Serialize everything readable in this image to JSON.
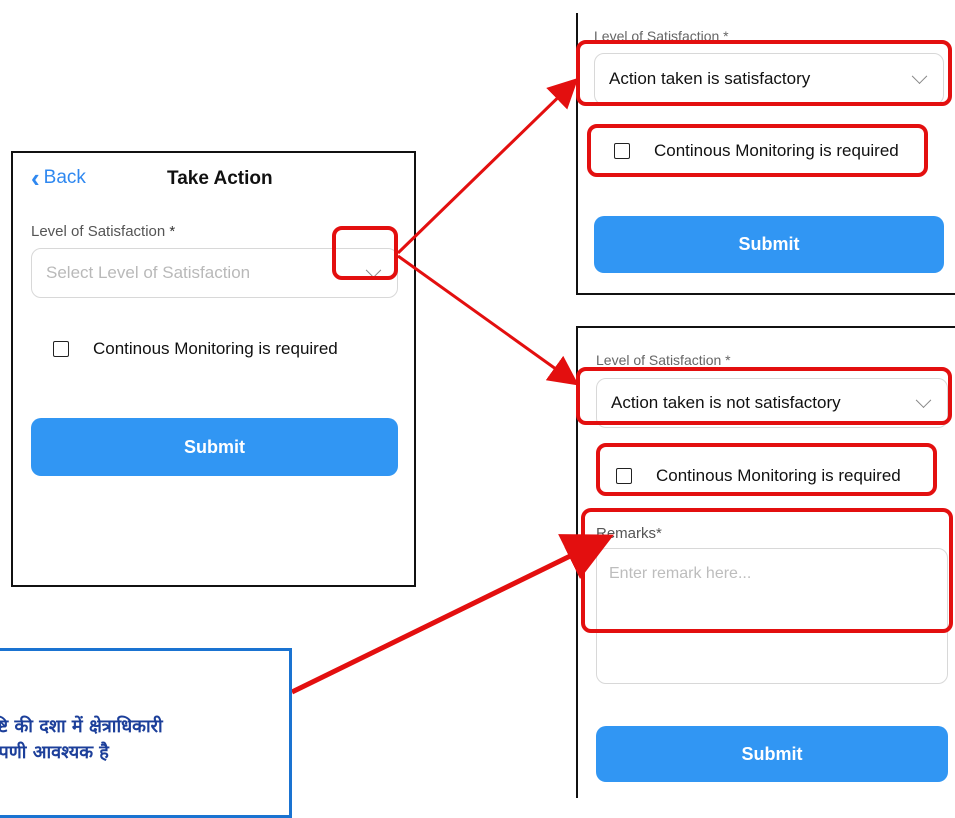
{
  "main_screen": {
    "back_label": "Back",
    "title": "Take Action",
    "satisfaction_label": "Level of Satisfaction",
    "required_mark": "*",
    "select_placeholder": "Select Level of Satisfaction",
    "checkbox_label": "Continous Monitoring is required",
    "submit_label": "Submit"
  },
  "satisfactory_screen": {
    "satisfaction_label": "Level of Satisfaction *",
    "selected_value": "Action taken is satisfactory",
    "checkbox_label": "Continous Monitoring is required",
    "submit_label": "Submit"
  },
  "not_satisfactory_screen": {
    "satisfaction_label": "Level of Satisfaction *",
    "selected_value": "Action taken is not satisfactory",
    "checkbox_label": "Continous Monitoring is required",
    "remarks_label": "Remarks*",
    "remarks_placeholder": "Enter remark here...",
    "submit_label": "Submit"
  },
  "note": {
    "line1": "ष्टि की दशा में क्षेत्राधिकारी",
    "line2": "प्पणी आवश्यक है"
  },
  "colors": {
    "accent": "#3196f3",
    "highlight": "#e30f0f",
    "note_border": "#1a73d1",
    "note_text": "#1c3f9a"
  }
}
